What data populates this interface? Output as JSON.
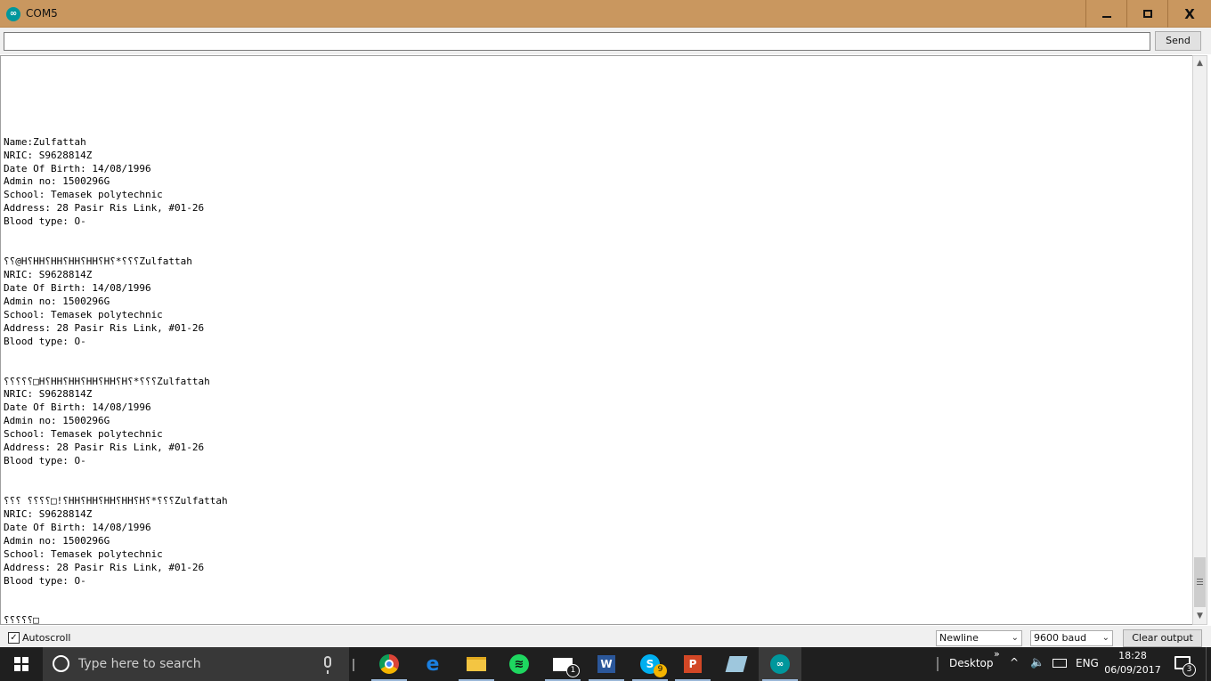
{
  "window": {
    "title": "COM5",
    "icon_label": "∞",
    "minimize_icon": "minimize-icon",
    "maximize_icon": "maximize-icon",
    "close_label": "X"
  },
  "input": {
    "value": "",
    "send_label": "Send"
  },
  "output": {
    "lines": [
      "",
      "",
      "",
      "",
      "",
      "",
      "Name:Zulfattah",
      "NRIC: S9628814Z",
      "Date Of Birth: 14/08/1996",
      "Admin no: 1500296G",
      "School: Temasek polytechnic",
      "Address: 28 Pasir Ris Link, #01-26",
      "Blood type: O-",
      "",
      "",
      "⸮⸮@H⸮HH⸮HH⸮HH⸮HH⸮H⸮*⸮⸮⸮Zulfattah",
      "NRIC: S9628814Z",
      "Date Of Birth: 14/08/1996",
      "Admin no: 1500296G",
      "School: Temasek polytechnic",
      "Address: 28 Pasir Ris Link, #01-26",
      "Blood type: O-",
      "",
      "",
      "⸮⸮⸮⸮⸮□H⸮HH⸮HH⸮HH⸮HH⸮H⸮*⸮⸮⸮Zulfattah",
      "NRIC: S9628814Z",
      "Date Of Birth: 14/08/1996",
      "Admin no: 1500296G",
      "School: Temasek polytechnic",
      "Address: 28 Pasir Ris Link, #01-26",
      "Blood type: O-",
      "",
      "",
      "⸮⸮⸮ ⸮⸮⸮⸮□!⸮HH⸮HH⸮HH⸮HH⸮H⸮*⸮⸮⸮Zulfattah",
      "NRIC: S9628814Z",
      "Date Of Birth: 14/08/1996",
      "Admin no: 1500296G",
      "School: Temasek polytechnic",
      "Address: 28 Pasir Ris Link, #01-26",
      "Blood type: O-",
      "",
      "",
      "⸮⸮⸮⸮⸮□"
    ]
  },
  "bottom": {
    "autoscroll_label": "Autoscroll",
    "autoscroll_checked": true,
    "line_ending": "Newline",
    "baud": "9600 baud",
    "clear_label": "Clear output"
  },
  "taskbar": {
    "search_placeholder": "Type here to search",
    "apps": [
      {
        "name": "chrome-icon",
        "glyph": ""
      },
      {
        "name": "edge-icon",
        "glyph": "e"
      },
      {
        "name": "file-explorer-icon",
        "glyph": ""
      },
      {
        "name": "spotify-icon",
        "glyph": "≋"
      },
      {
        "name": "mail-icon",
        "glyph": "",
        "badge": "1"
      },
      {
        "name": "word-icon",
        "glyph": "W"
      },
      {
        "name": "skype-icon",
        "glyph": "S",
        "badge": "9"
      },
      {
        "name": "powerpoint-icon",
        "glyph": "P"
      },
      {
        "name": "paper-icon",
        "glyph": ""
      },
      {
        "name": "arduino-icon",
        "glyph": "∞",
        "active": true
      }
    ],
    "desktop_label": "Desktop",
    "desktop_chevron": "»",
    "tray_up": "^",
    "volume": "🔈",
    "language": "ENG",
    "time": "18:28",
    "date": "06/09/2017",
    "notifications_count": "3"
  }
}
